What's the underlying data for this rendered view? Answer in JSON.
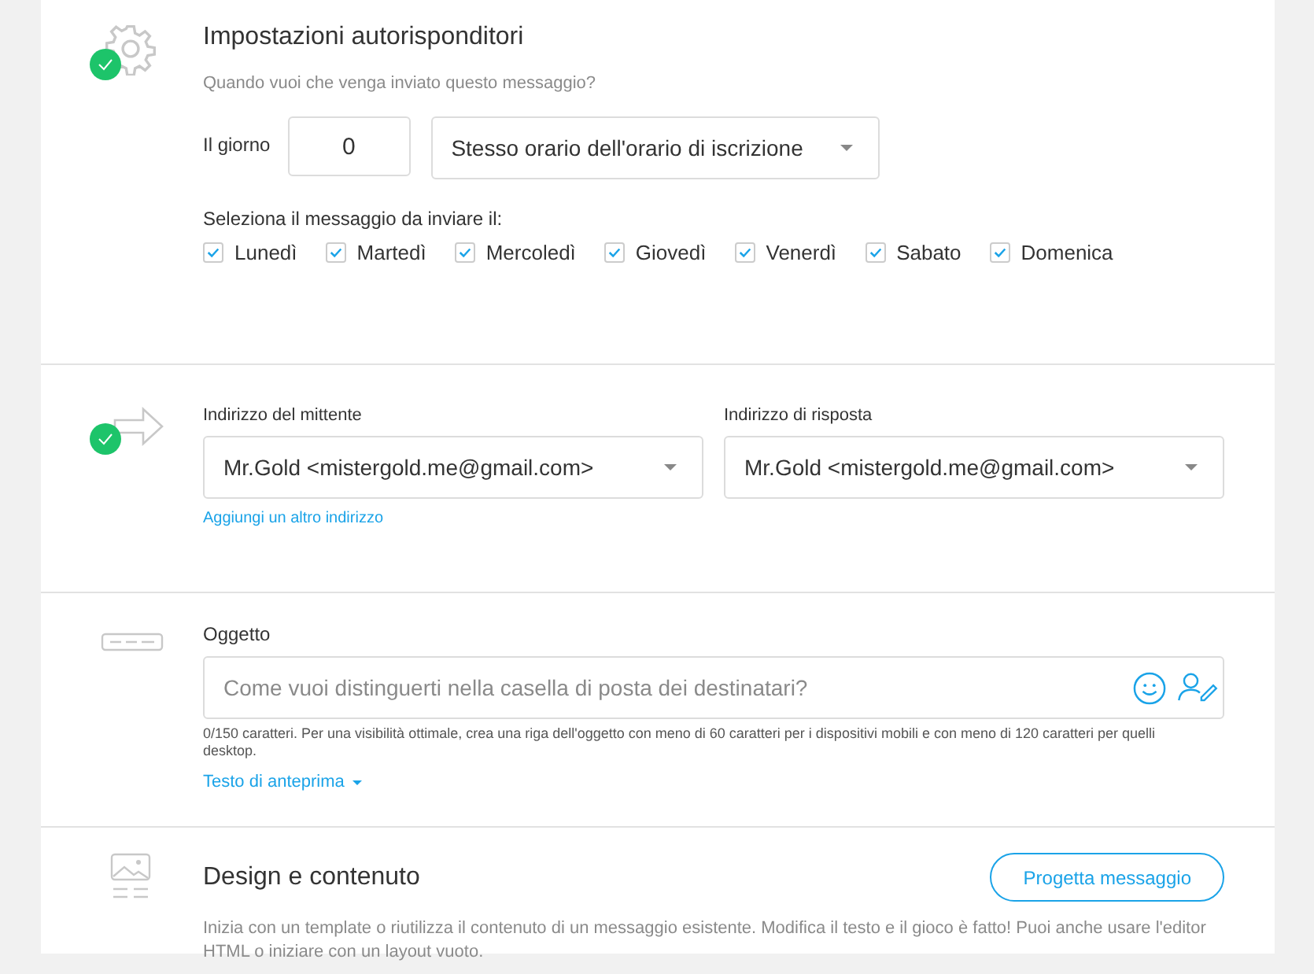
{
  "autoresponder": {
    "completed": true,
    "title": "Impostazioni autorisponditori",
    "question": "Quando vuoi che venga inviato questo messaggio?",
    "day_label": "Il giorno",
    "day_value": "0",
    "time_select": "Stesso orario dell'orario di iscrizione",
    "days_label": "Seleziona il messaggio da inviare il:",
    "days": [
      {
        "label": "Lunedì",
        "checked": true
      },
      {
        "label": "Martedì",
        "checked": true
      },
      {
        "label": "Mercoledì",
        "checked": true
      },
      {
        "label": "Giovedì",
        "checked": true
      },
      {
        "label": "Venerdì",
        "checked": true
      },
      {
        "label": "Sabato",
        "checked": true
      },
      {
        "label": "Domenica",
        "checked": true
      }
    ]
  },
  "sender": {
    "completed": true,
    "from_label": "Indirizzo del mittente",
    "from_value": "Mr.Gold <mistergold.me@gmail.com>",
    "reply_label": "Indirizzo di risposta",
    "reply_value": "Mr.Gold <mistergold.me@gmail.com>",
    "add_link": "Aggiungi un altro indirizzo"
  },
  "subject": {
    "label": "Oggetto",
    "placeholder": "Come vuoi distinguerti nella casella di posta dei destinatari?",
    "hint": "0/150 caratteri. Per una visibilità ottimale, crea una riga dell'oggetto con meno di 60 caratteri per i dispositivi mobili e con meno di 120 caratteri per quelli desktop.",
    "preview_link": "Testo di anteprima"
  },
  "design": {
    "title": "Design e contenuto",
    "button": "Progetta messaggio",
    "description": "Inizia con un template o riutilizza il contenuto di un messaggio esistente. Modifica il testo e il gioco è fatto! Puoi anche usare l'editor HTML o iniziare con un layout vuoto."
  }
}
